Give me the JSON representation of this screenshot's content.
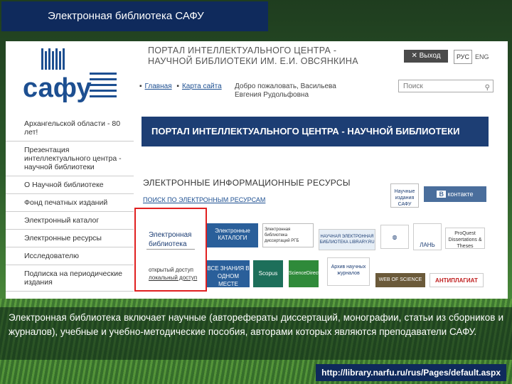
{
  "slide": {
    "title": "Электронная библиотека САФУ",
    "caption": "Электронная библиотека включает научные (авторефераты диссертаций, монографии, статьи из сборников и журналов), учебные и учебно-методические пособия, авторами которых являются преподаватели САФУ.",
    "url": "http://library.narfu.ru/rus/Pages/default.aspx"
  },
  "site": {
    "logo_text": "сафу",
    "portal_title_line1": "ПОРТАЛ ИНТЕЛЛЕКТУАЛЬНОГО ЦЕНТРА -",
    "portal_title_line2": "НАУЧНОЙ БИБЛИОТЕКИ ИМ. Е.И. ОВСЯНКИНА",
    "exit_label": "Выход",
    "lang_ru": "РУС",
    "lang_en": "ENG",
    "breadcrumb_home": "Главная",
    "breadcrumb_sitemap": "Карта сайта",
    "welcome": "Добро пожаловать, Васильева Евгения Рудольфовна",
    "search_placeholder": "Поиск",
    "sidebar_items": [
      "Архангельской области - 80 лет!",
      "Презентация интеллектуального центра - научной библиотеки",
      "О Научной библиотеке",
      "Фонд печатных изданий",
      "Электронный каталог",
      "Электронные ресурсы",
      "Исследователю",
      "Подписка на периодические издания"
    ],
    "banner": "ПОРТАЛ ИНТЕЛЛЕКТУАЛЬНОГО ЦЕНТРА - НАУЧНОЙ БИБЛИОТЕКИ",
    "section_title": "ЭЛЕКТРОННЫЕ ИНФОРМАЦИОННЫЕ РЕСУРСЫ",
    "section_link": "ПОИСК ПО ЭЛЕКТРОННЫМ РЕСУРСАМ",
    "el_lib_line1": "Электронная",
    "el_lib_line2": "библиотека",
    "open_access_line1": "открытый доступ",
    "open_access_line2": "локальный доступ",
    "resources": {
      "catalogs": "Электронные КАТАЛОГИ",
      "rgb": "Электронная библиотека диссертаций РГБ",
      "elibrary": "НАУЧНАЯ ЭЛЕКТРОННАЯ БИБЛИОТЕКА LIBRARY.RU",
      "lan": "ЛАНЬ",
      "proquest": "ProQuest Dissertations & Theses",
      "znanium": "ВСЕ ЗНАНИЯ В ОДНОМ МЕСТЕ znanium.com",
      "scopus": "Scopus",
      "sciencedirect": "ScienceDirect",
      "arctic": "Архив научных журналов",
      "web_of_science": "WEB OF SCIENCE",
      "antiplagiat": "АНТИПЛАГИАТ",
      "naukn": "Научные издания САФУ",
      "vk": "В",
      "vk_text": "контакте"
    }
  },
  "colors": {
    "title_bg": "#0f2a5c",
    "banner_bg": "#1d3e74",
    "highlight": "#e02020"
  }
}
